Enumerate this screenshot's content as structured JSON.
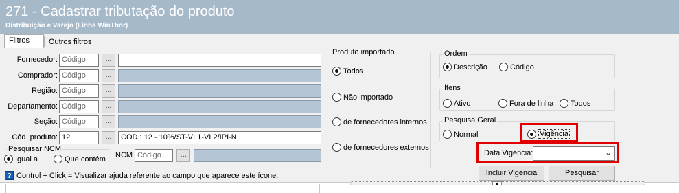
{
  "header": {
    "title": "271 - Cadastrar tributação do produto",
    "subtitle": "Distribuição e Varejo (Linha WinThor)"
  },
  "tabs": [
    {
      "label": "Filtros"
    },
    {
      "label": "Outros filtros"
    }
  ],
  "filters": {
    "fornecedor": {
      "label": "Fornecedor:",
      "placeholder": "Código",
      "button": "..."
    },
    "comprador": {
      "label": "Comprador:",
      "placeholder": "Código",
      "button": "..."
    },
    "regiao": {
      "label": "Região:",
      "placeholder": "Código",
      "button": "..."
    },
    "departamento": {
      "label": "Departamento:",
      "placeholder": "Código",
      "button": "..."
    },
    "secao": {
      "label": "Seção:",
      "placeholder": "Código",
      "button": "..."
    },
    "cod_produto": {
      "label": "Cód. produto:",
      "value": "12",
      "button": "...",
      "description": "COD.: 12 - 10%/ST-VL1-VL2/IPI-N"
    }
  },
  "pesquisar_ncm": {
    "title": "Pesquisar NCM",
    "options": [
      "Igual a",
      "Que contém"
    ],
    "selected": "Igual a",
    "ncm_label": "NCM",
    "ncm_placeholder": "Código",
    "button": "..."
  },
  "produto_importado": {
    "title": "Produto importado",
    "options": [
      "Todos",
      "Não importado",
      "de fornecedores internos",
      "de fornecedores externos"
    ],
    "selected": "Todos"
  },
  "ordem": {
    "title": "Ordem",
    "options": [
      "Descrição",
      "Código"
    ],
    "selected": "Descrição"
  },
  "itens": {
    "title": "Itens",
    "options": [
      "Ativo",
      "Fora de linha",
      "Todos"
    ],
    "selected": ""
  },
  "pesquisa_geral": {
    "title": "Pesquisa Geral",
    "options": [
      "Normal",
      "Vigência"
    ],
    "selected": "Vigência"
  },
  "data_vigencia": {
    "label": "Data Vigência:",
    "value": ""
  },
  "buttons": {
    "incluir_vigencia": "Incluir Vigência",
    "pesquisar": "Pesquisar"
  },
  "help_text": "Control + Click = Visualizar ajuda referente ao campo que aparece este ícone.",
  "colors": {
    "header_bg": "#a6b9c9",
    "highlight": "#e00000",
    "desc_field": "#b4c5d6"
  }
}
